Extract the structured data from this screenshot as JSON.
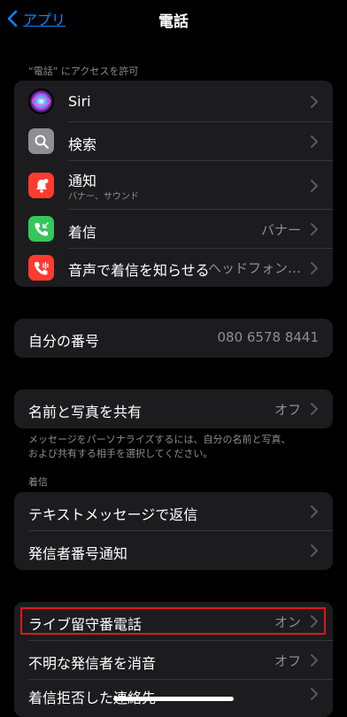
{
  "header": {
    "back_label": "アプリ",
    "title": "電話"
  },
  "access_section": {
    "caption": "“電話” にアクセスを許可",
    "items": [
      {
        "label": "Siri",
        "sublabel": "",
        "value": ""
      },
      {
        "label": "検索",
        "sublabel": "",
        "value": ""
      },
      {
        "label": "通知",
        "sublabel": "バナー、サウンド",
        "value": ""
      },
      {
        "label": "着信",
        "sublabel": "",
        "value": "バナー"
      },
      {
        "label": "音声で着信を知らせる",
        "sublabel": "",
        "value": "ヘッドフォン…"
      }
    ]
  },
  "my_number": {
    "label": "自分の番号",
    "value": "080 6578 8441"
  },
  "share": {
    "label": "名前と写真を共有",
    "value": "オフ",
    "footer_line1": "メッセージをパーソナライズするには、自分の名前と写真、",
    "footer_line2": "および共有する相手を選択してください。"
  },
  "incoming_section": {
    "caption": "着信",
    "items": [
      {
        "label": "テキストメッセージで返信"
      },
      {
        "label": "発信者番号通知"
      }
    ]
  },
  "voicemail_section": {
    "items": [
      {
        "label": "ライブ留守番電話",
        "value": "オン"
      },
      {
        "label": "不明な発信者を消音",
        "value": "オフ"
      },
      {
        "label": "着信拒否した連絡先",
        "value": ""
      }
    ]
  },
  "colors": {
    "background": "#000000",
    "group_bg": "#1c1c1e",
    "accent": "#0a84ff",
    "secondary_text": "#8e8e93",
    "highlight": "#e0161e",
    "search_icon": "#8e8e93",
    "notification_icon": "#ff3b30",
    "incoming_icon": "#34c759",
    "announce_icon": "#ff3b30"
  },
  "icons": [
    "chevron-left-icon",
    "siri-icon",
    "search-icon",
    "notification-icon",
    "incoming-call-icon",
    "announce-call-icon",
    "chevron-right-icon"
  ]
}
